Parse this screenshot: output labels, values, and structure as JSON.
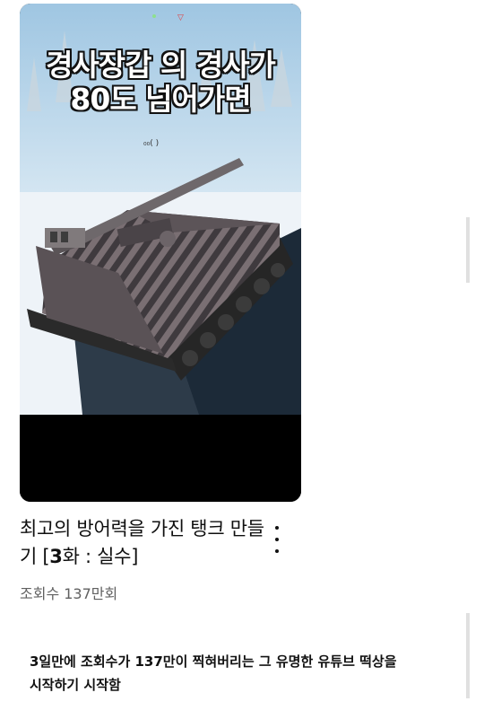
{
  "video": {
    "thumbnail_overlay_line1": "경사장갑 의 경사가",
    "thumbnail_overlay_line2": "80도 넘어가면",
    "title_part1": "최고의 방어력을 가진 탱크 만들기 [",
    "title_episode": "3",
    "title_part2": "화 : 실수]",
    "views": "조회수 137만회",
    "more_icon": "vertical-ellipsis-icon"
  },
  "caption": {
    "line1": "3일만에 조회수가 137만이 찍혀버리는 그 유명한 유튜브 떡상을",
    "line2": "시작하기 시작함"
  }
}
